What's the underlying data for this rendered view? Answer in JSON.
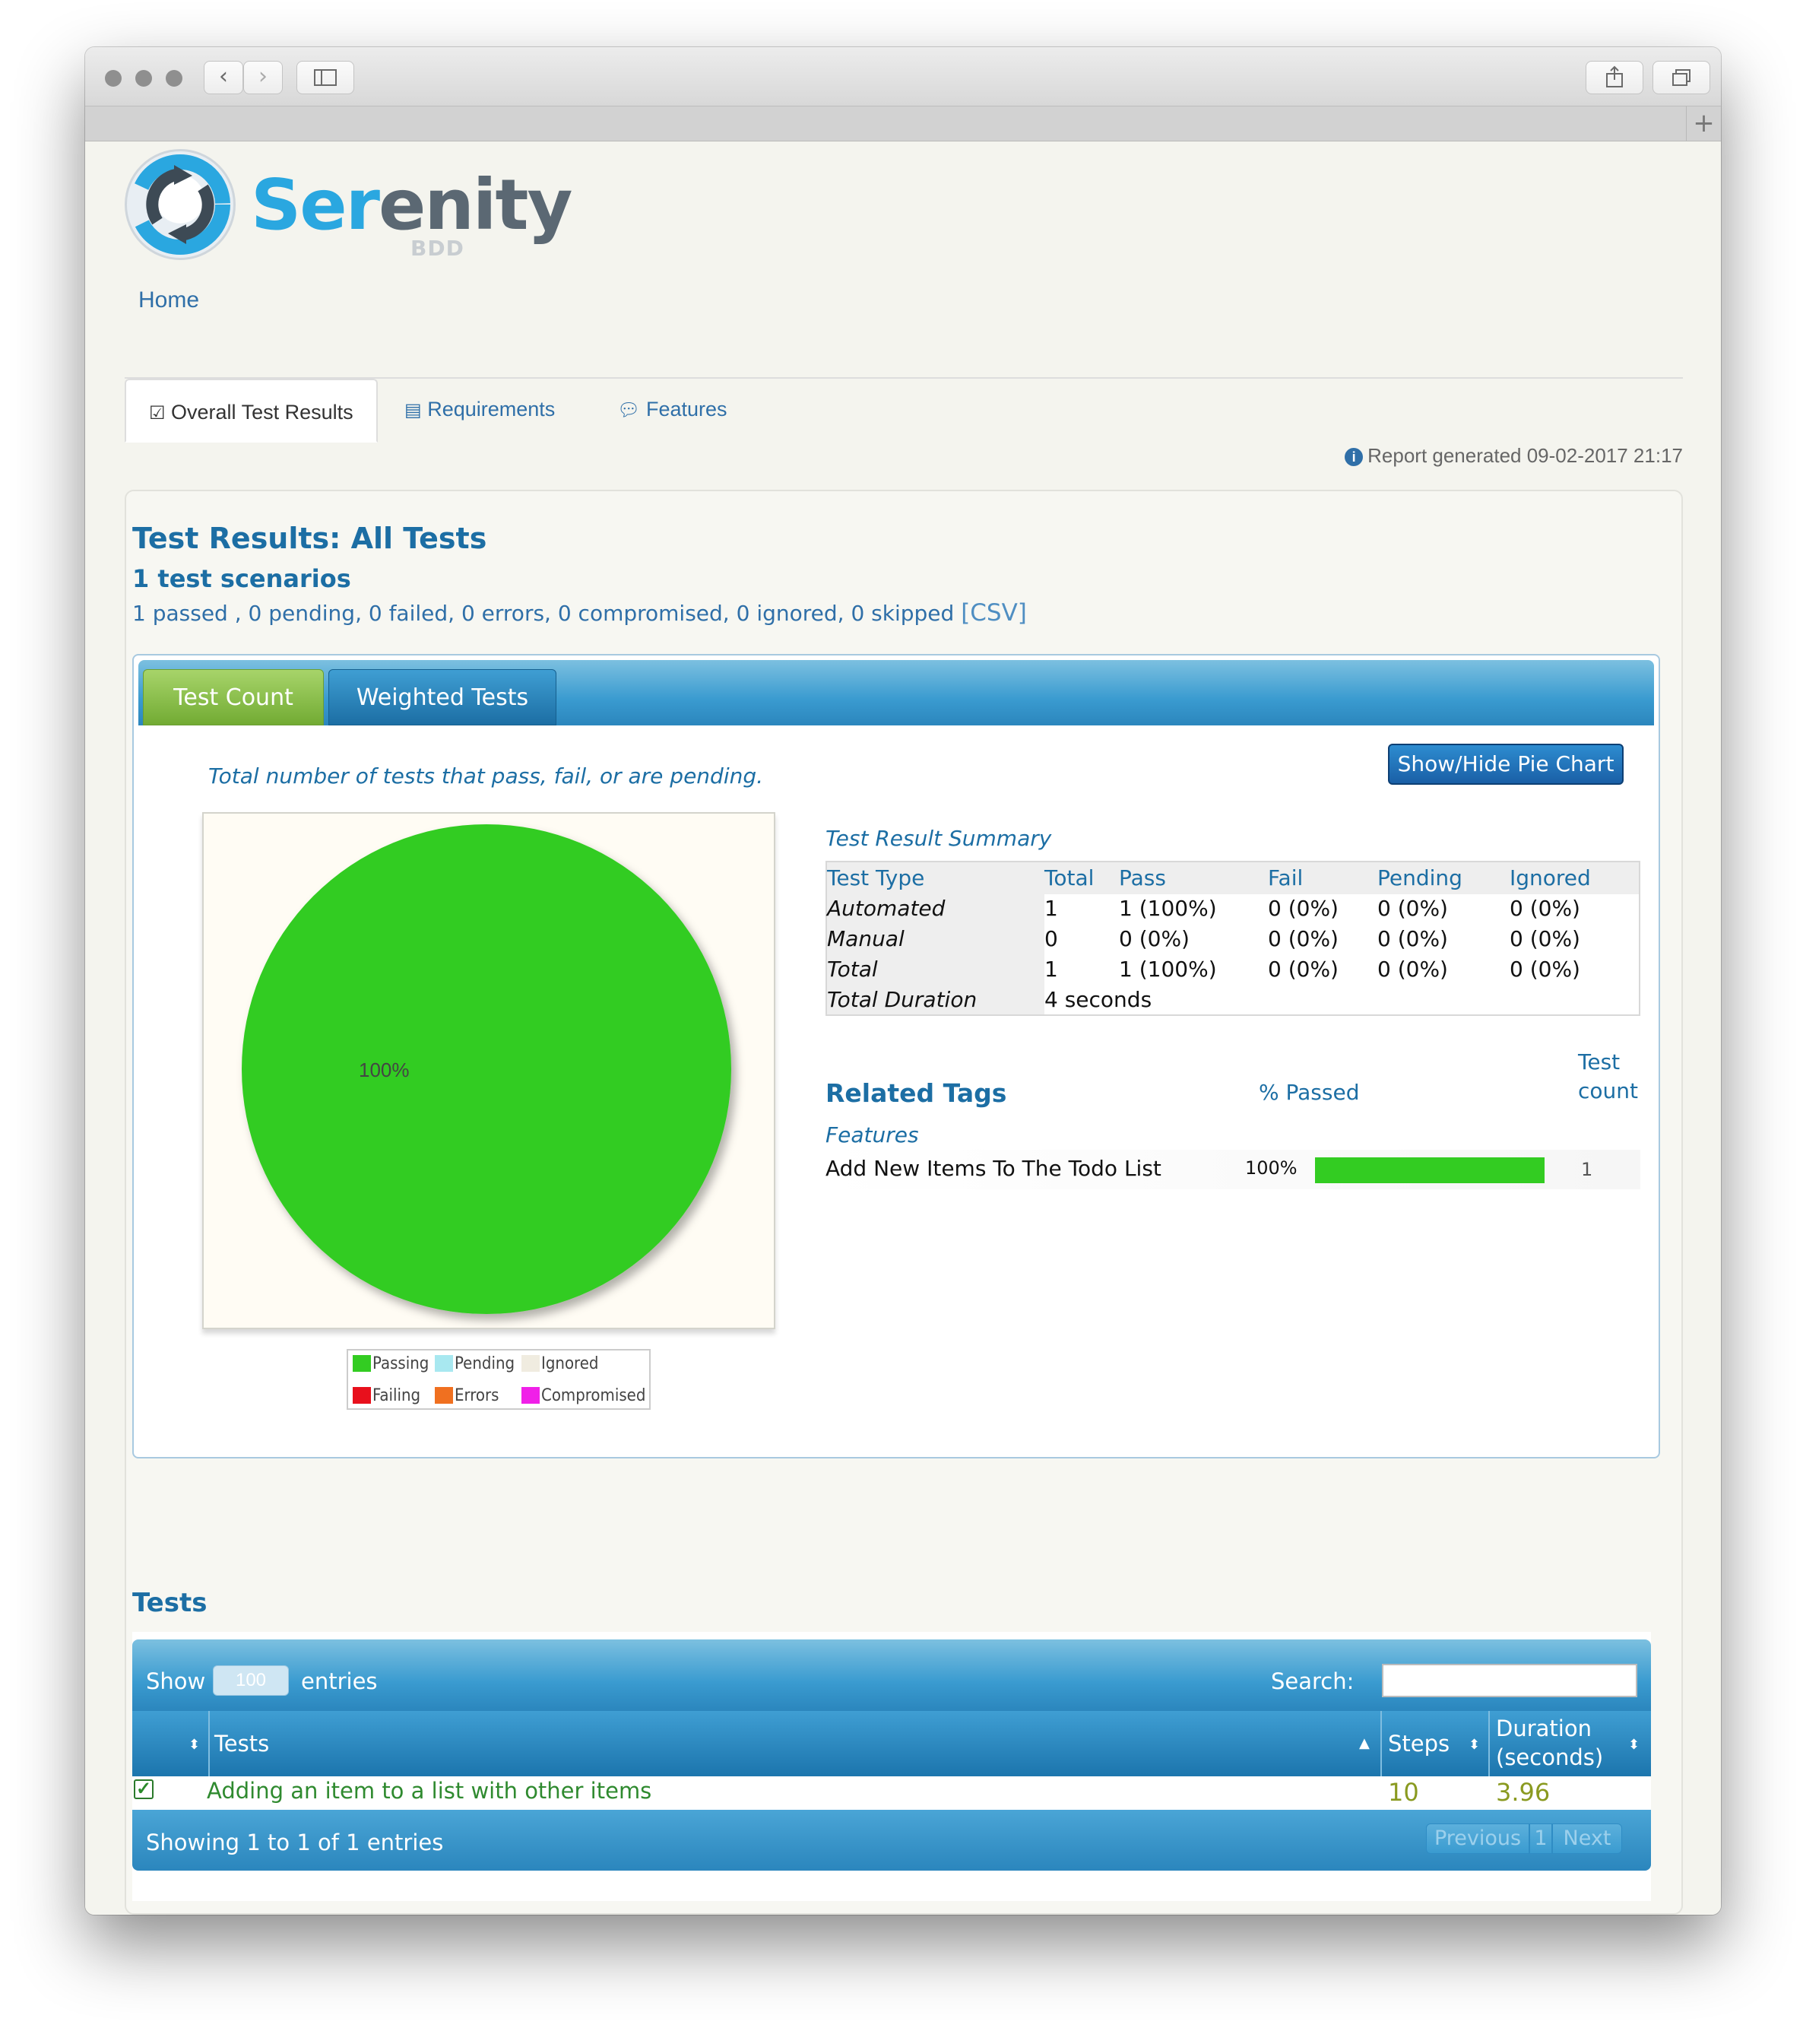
{
  "browser": {
    "back_icon": "chevron-left-icon",
    "forward_icon": "chevron-right-icon",
    "sidebar_icon": "sidebar-icon",
    "share_icon": "share-icon",
    "tabs_icon": "tabs-overview-icon",
    "new_tab_label": "+"
  },
  "logo": {
    "text_main": "Ser",
    "text_dark": "enity",
    "subtitle": "BDD"
  },
  "breadcrumb": {
    "home": "Home"
  },
  "nav": {
    "tabs": [
      {
        "label": "Overall Test Results",
        "icon": "checkbox-icon",
        "active": true
      },
      {
        "label": "Requirements",
        "icon": "book-icon",
        "active": false
      },
      {
        "label": "Features",
        "icon": "comments-icon",
        "active": false
      }
    ],
    "report_generated": "Report generated 09-02-2017 21:17"
  },
  "results": {
    "title": "Test Results: All Tests",
    "scenarios": "1 test scenarios",
    "passed": "1 passed",
    "rest": " , 0 pending, 0 failed, 0 errors, 0 compromised, 0 ignored, 0 skipped ",
    "csv": "[CSV]"
  },
  "chart_tabs": {
    "test_count": "Test Count",
    "weighted": "Weighted Tests",
    "description": "Total number of tests that pass, fail, or are pending.",
    "toggle_button": "Show/Hide Pie Chart"
  },
  "chart_data": {
    "type": "pie",
    "slices": [
      {
        "name": "Passing",
        "value": 100,
        "color": "#33cc22"
      },
      {
        "name": "Pending",
        "value": 0,
        "color": "#a8e8f0"
      },
      {
        "name": "Ignored",
        "value": 0,
        "color": "#f0ece0"
      },
      {
        "name": "Failing",
        "value": 0,
        "color": "#e8101c"
      },
      {
        "name": "Errors",
        "value": 0,
        "color": "#f07020"
      },
      {
        "name": "Compromised",
        "value": 0,
        "color": "#f020e8"
      }
    ],
    "data_label": "100%",
    "legend_position": "bottom"
  },
  "summary": {
    "title": "Test Result Summary",
    "headers": [
      "Test Type",
      "Total",
      "Pass",
      "Fail",
      "Pending",
      "Ignored"
    ],
    "rows": [
      [
        "Automated",
        "1",
        "1 (100%)",
        "0 (0%)",
        "0 (0%)",
        "0 (0%)"
      ],
      [
        "Manual",
        "0",
        "0 (0%)",
        "0 (0%)",
        "0 (0%)",
        "0 (0%)"
      ],
      [
        "Total",
        "1",
        "1 (100%)",
        "0 (0%)",
        "0 (0%)",
        "0 (0%)"
      ]
    ],
    "duration_label": "Total Duration",
    "duration_value": "4 seconds"
  },
  "related_tags": {
    "title": "Related Tags",
    "passed_header": "% Passed",
    "count_header_1": "Test",
    "count_header_2": "count",
    "group": "Features",
    "items": [
      {
        "name": "Add New Items To The Todo List",
        "percent": "100%",
        "pass_fraction": 1.0,
        "count": "1"
      }
    ]
  },
  "tests": {
    "title": "Tests",
    "show_label": "Show",
    "entries_value": "100",
    "entries_label": "entries",
    "search_label": "Search:",
    "search_value": "",
    "columns": [
      "Tests",
      "Steps",
      "Duration",
      "(seconds)"
    ],
    "rows": [
      {
        "name": "Adding an item to a list with other items",
        "steps": "10",
        "duration": "3.96",
        "status_icon": "check-square-icon"
      }
    ],
    "footer": "Showing 1 to 1 of 1 entries",
    "pager": {
      "previous": "Previous",
      "page": "1",
      "next": "Next"
    }
  }
}
